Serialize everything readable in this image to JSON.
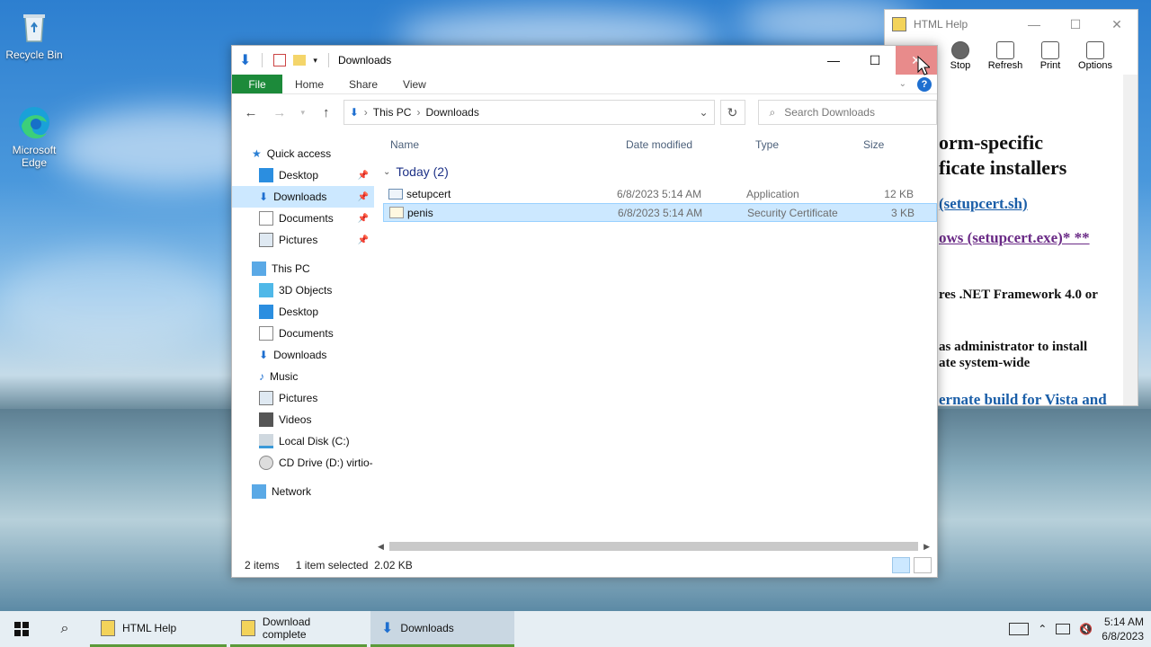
{
  "desktop": {
    "icons": [
      {
        "label": "Recycle Bin"
      },
      {
        "label": "Microsoft Edge"
      }
    ]
  },
  "help_window": {
    "title": "HTML Help",
    "toolbar": [
      "Stop",
      "Refresh",
      "Print",
      "Options"
    ],
    "content": {
      "heading_line1": "orm-specific",
      "heading_line2": "ficate installers",
      "link1": "(setupcert.sh)",
      "link2": "ows (setupcert.exe)* **",
      "text1": "res .NET Framework 4.0 or",
      "text2_line1": "as administrator to install",
      "text2_line2": "ate system-wide",
      "link3": "ernate build for Vista and"
    }
  },
  "explorer": {
    "title": "Downloads",
    "ribbon_tabs": [
      "File",
      "Home",
      "Share",
      "View"
    ],
    "address": {
      "root": "This PC",
      "current": "Downloads"
    },
    "search_placeholder": "Search Downloads",
    "nav": {
      "quick_access": "Quick access",
      "quick_items": [
        "Desktop",
        "Downloads",
        "Documents",
        "Pictures"
      ],
      "this_pc": "This PC",
      "pc_items": [
        "3D Objects",
        "Desktop",
        "Documents",
        "Downloads",
        "Music",
        "Pictures",
        "Videos",
        "Local Disk (C:)",
        "CD Drive (D:) virtio-"
      ],
      "network": "Network"
    },
    "columns": {
      "name": "Name",
      "date": "Date modified",
      "type": "Type",
      "size": "Size"
    },
    "group": "Today (2)",
    "files": [
      {
        "name": "setupcert",
        "date": "6/8/2023 5:14 AM",
        "type": "Application",
        "size": "12 KB"
      },
      {
        "name": "penis",
        "date": "6/8/2023 5:14 AM",
        "type": "Security Certificate",
        "size": "3 KB"
      }
    ],
    "status": {
      "count": "2 items",
      "selected": "1 item selected",
      "size": "2.02 KB"
    }
  },
  "taskbar": {
    "apps": [
      {
        "label": "HTML Help"
      },
      {
        "label": "Download complete"
      },
      {
        "label": "Downloads"
      }
    ],
    "time": "5:14 AM",
    "date": "6/8/2023"
  },
  "colors": {
    "file_tab": "#1c8a3a",
    "selection": "#cce8ff",
    "close_hover": "#e88b8b",
    "taskbar": "#e6eef3"
  }
}
